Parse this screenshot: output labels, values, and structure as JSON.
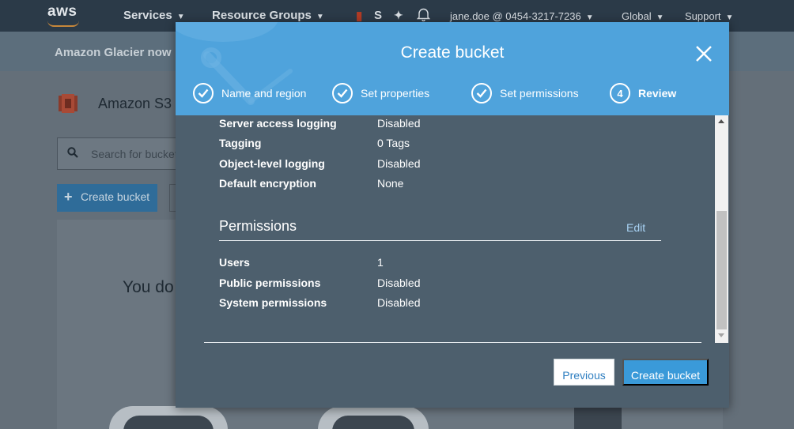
{
  "topnav": {
    "logo": "aws",
    "services": "Services",
    "resource_groups": "Resource Groups",
    "truncated_item": "S",
    "account": "jane.doe @ 0454-3217-7236",
    "region": "Global",
    "support": "Support"
  },
  "announcement": {
    "text": "Amazon Glacier now"
  },
  "page": {
    "title": "Amazon S3",
    "search_placeholder": "Search for bucket",
    "create_bucket_label": "Create bucket",
    "empty_text": "You do"
  },
  "modal": {
    "title": "Create bucket",
    "steps": [
      {
        "label": "Name and region",
        "state": "done"
      },
      {
        "label": "Set properties",
        "state": "done"
      },
      {
        "label": "Set permissions",
        "state": "done"
      },
      {
        "number": "4",
        "label": "Review",
        "state": "active"
      }
    ],
    "properties": [
      {
        "label": "Server access logging",
        "value": "Disabled"
      },
      {
        "label": "Tagging",
        "value": "0 Tags"
      },
      {
        "label": "Object-level logging",
        "value": "Disabled"
      },
      {
        "label": "Default encryption",
        "value": "None"
      }
    ],
    "permissions": {
      "heading": "Permissions",
      "edit_label": "Edit",
      "rows": [
        {
          "label": "Users",
          "value": "1"
        },
        {
          "label": "Public permissions",
          "value": "Disabled"
        },
        {
          "label": "System permissions",
          "value": "Disabled"
        }
      ]
    },
    "previous_label": "Previous",
    "create_label": "Create bucket"
  },
  "colors": {
    "header_blue": "#4fa3dc",
    "modal_body": "#4d5f6d",
    "primary_button": "#3a9ad9",
    "link": "#a9d3f5"
  }
}
